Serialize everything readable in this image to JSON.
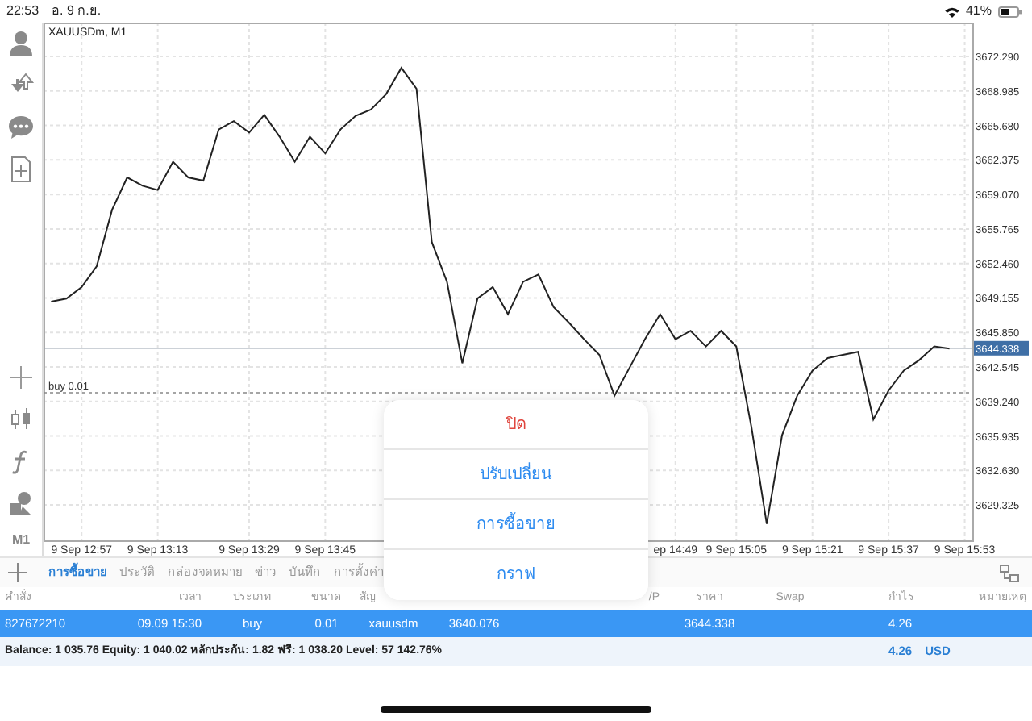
{
  "status_bar": {
    "time": "22:53",
    "date": "อ. 9 ก.ย.",
    "battery": "41%"
  },
  "toolbar": {
    "timeframe": "M1"
  },
  "chart": {
    "symbol": "XAUUSDm, M1",
    "chart_data": {
      "type": "line",
      "grid": true,
      "categories": [
        null,
        null,
        "9 Sep 12:57",
        null,
        null,
        null,
        null,
        "9 Sep 13:13",
        null,
        null,
        null,
        null,
        null,
        "9 Sep 13:29",
        null,
        null,
        null,
        null,
        "9 Sep 13:45",
        null,
        null,
        null,
        null,
        null,
        null,
        null,
        null,
        null,
        null,
        null,
        null,
        null,
        null,
        null,
        null,
        null,
        null,
        null,
        null,
        null,
        null,
        "ep 14:49",
        null,
        null,
        null,
        "9 Sep 15:05",
        null,
        null,
        null,
        null,
        "9 Sep 15:21",
        null,
        null,
        null,
        null,
        "9 Sep 15:37",
        null,
        null,
        null,
        null,
        "9 Sep 15:53"
      ],
      "ylim": [
        3625.93,
        3675.54
      ],
      "yticks": [
        {
          "value": 3672.29,
          "label": "3672.290"
        },
        {
          "value": 3668.985,
          "label": "3668.985"
        },
        {
          "value": 3665.68,
          "label": "3665.680"
        },
        {
          "value": 3662.375,
          "label": "3662.375"
        },
        {
          "value": 3659.07,
          "label": "3659.070"
        },
        {
          "value": 3655.765,
          "label": "3655.765"
        },
        {
          "value": 3652.46,
          "label": "3652.460"
        },
        {
          "value": 3649.155,
          "label": "3649.155"
        },
        {
          "value": 3645.85,
          "label": "3645.850"
        },
        {
          "value": 3642.545,
          "label": "3642.545"
        },
        {
          "value": 3639.24,
          "label": "3639.240"
        },
        {
          "value": 3635.935,
          "label": "3635.935"
        },
        {
          "value": 3632.63,
          "label": "3632.630"
        },
        {
          "value": 3629.325,
          "label": "3629.325"
        }
      ],
      "series": [
        {
          "color": "#222222",
          "values": [
            3648.8,
            3649.1,
            3650.2,
            3652.2,
            3657.6,
            3660.7,
            3659.9,
            3659.5,
            3662.2,
            3660.7,
            3660.4,
            3665.3,
            3666.1,
            3665.0,
            3666.7,
            3664.6,
            3662.2,
            3664.6,
            3663.0,
            3665.3,
            3666.6,
            3667.2,
            3668.7,
            3671.2,
            3669.2,
            3654.5,
            3650.7,
            3642.9,
            3649.1,
            3650.2,
            3647.6,
            3650.7,
            3651.4,
            3648.3,
            3646.8,
            3645.2,
            3643.7,
            3639.8,
            3642.5,
            3645.2,
            3647.6,
            3645.2,
            3646.0,
            3644.5,
            3646.0,
            3644.5,
            3636.7,
            3627.5,
            3636.0,
            3639.8,
            3642.2,
            3643.4,
            3643.7,
            3644.0,
            3637.5,
            3640.3,
            3642.2,
            3643.2,
            3644.5,
            3644.3,
            null
          ]
        }
      ],
      "ref_lines": [
        {
          "axis": "y",
          "value": 3644.338,
          "label": "3644.338"
        },
        {
          "axis": "y",
          "value": 3640.076,
          "label": "buy 0.01"
        }
      ]
    }
  },
  "terminal": {
    "tabs": [
      {
        "label": "การซื้อขาย",
        "selected": true
      },
      {
        "label": "ประวัติ",
        "selected": false
      },
      {
        "label": "กล่องจดหมาย",
        "selected": false
      },
      {
        "label": "ข่าว",
        "selected": false
      },
      {
        "label": "บันทึก",
        "selected": false
      },
      {
        "label": "การตั้งค่า",
        "selected": false
      }
    ],
    "columns": [
      "คำสั่ง",
      "เวลา",
      "ประเภท",
      "ขนาด",
      "สัญ",
      null,
      null,
      "/P",
      "ราคา",
      "Swap",
      "กำไร",
      "หมายเหตุ"
    ],
    "rows": [
      {
        "selected": true,
        "cells": [
          "827672210",
          "09.09 15:30",
          "buy",
          "0.01",
          "xauusdm",
          "3640.076",
          null,
          null,
          "3644.338",
          null,
          "4.26",
          null
        ]
      }
    ],
    "summary": "Balance: 1 035.76 Equity: 1 040.02 หลักประกัน: 1.82 ฟรี: 1 038.20 Level: 57 142.76%",
    "total_profit": "4.26",
    "currency": "USD"
  },
  "action_sheet": {
    "items": [
      {
        "label": "ปิด",
        "kind": "destructive"
      },
      {
        "label": "ปรับเปลี่ยน",
        "kind": "default"
      },
      {
        "label": "การซื้อขาย",
        "kind": "default"
      },
      {
        "label": "กราฟ",
        "kind": "default"
      }
    ]
  }
}
